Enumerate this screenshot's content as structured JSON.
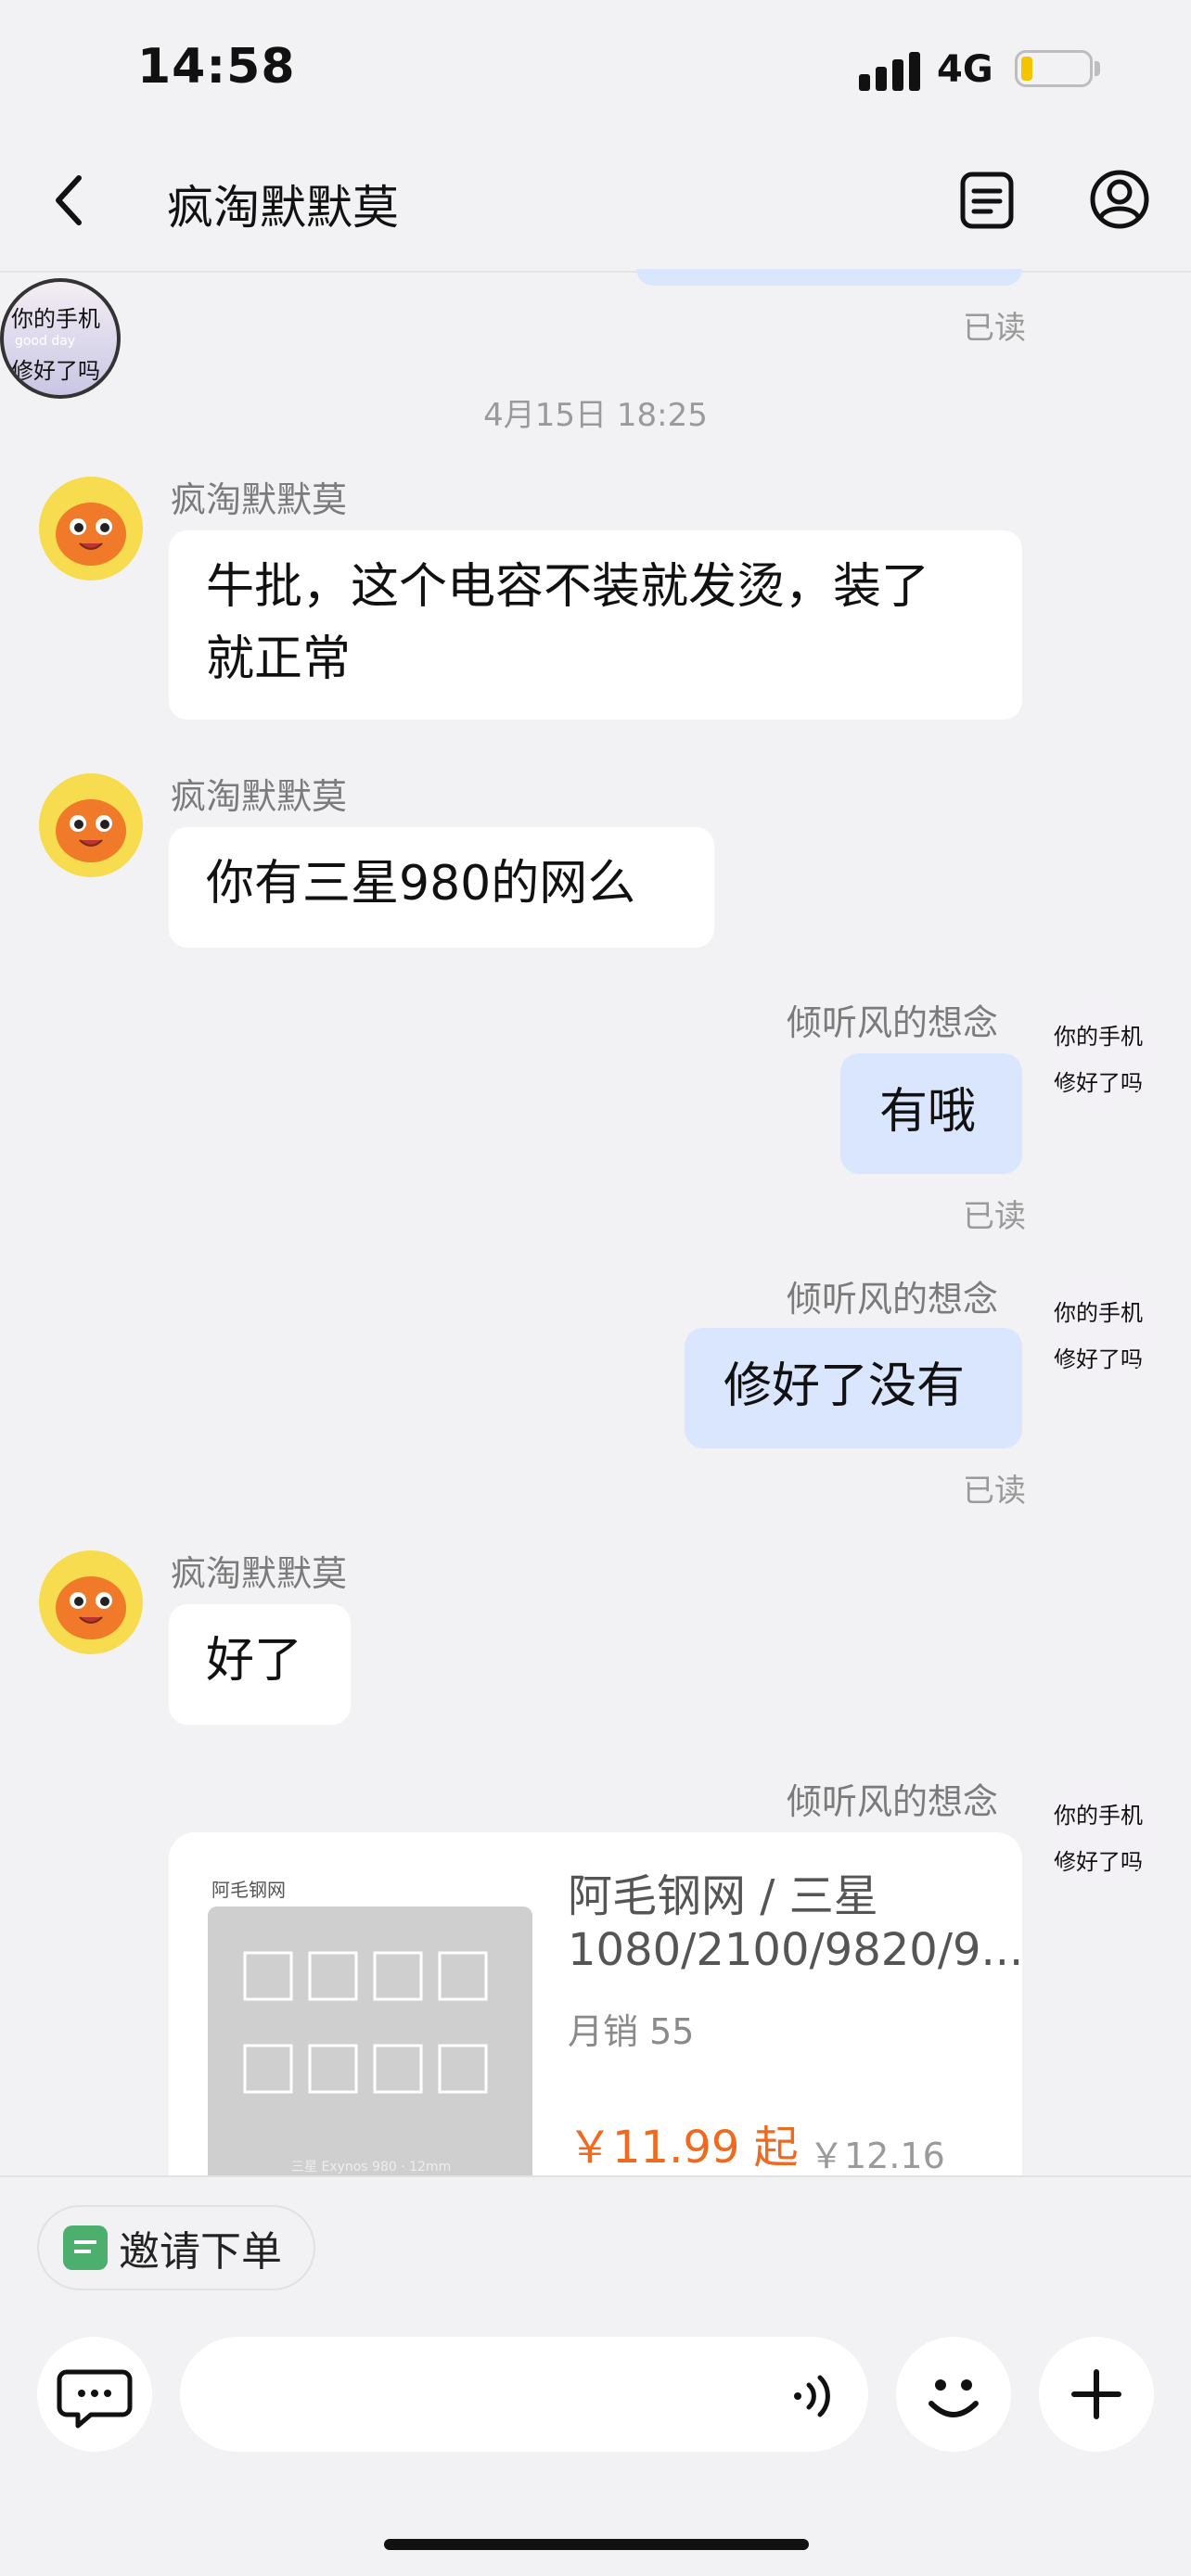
{
  "status_bar": {
    "time": "14:58",
    "network": "4G"
  },
  "header": {
    "title": "疯淘默默莫",
    "back_icon": "chevron-left-icon",
    "menu_icon": "list-icon",
    "profile_icon": "person-icon"
  },
  "chat": {
    "top_read": "已读",
    "timestamp": "4月15日 18:25",
    "messages": [
      {
        "sender": "疯淘默默莫",
        "text_line1": "牛批，这个电容不装就发烫，装了",
        "text_line2": "就正常"
      },
      {
        "sender": "疯淘默默莫",
        "text": "你有三星980的网么"
      },
      {
        "sender": "倾听风的想念",
        "text": "有哦",
        "status": "已读"
      },
      {
        "sender": "倾听风的想念",
        "text": "修好了没有",
        "status": "已读"
      },
      {
        "sender": "疯淘默默莫",
        "text": "好了"
      },
      {
        "sender": "倾听风的想念"
      }
    ],
    "avatar_text": {
      "line1": "你的手机",
      "middle": "good day",
      "line2": "修好了吗"
    },
    "product": {
      "title_line1": "阿毛钢网 / 三星",
      "title_line2": "1080/2100/9820/9...",
      "sales": "月销 55",
      "price": "￥11.99 起",
      "old_price": "￥12.16",
      "stencil_brand": "阿毛钢网",
      "stencil_caption": "三星 Exynos 980 · 12mm"
    }
  },
  "bottom": {
    "invite_label": "邀请下单"
  },
  "colors": {
    "accent_out": "#d9e6fd",
    "price": "#ef6a1e",
    "invite_icon": "#4caf6e"
  }
}
